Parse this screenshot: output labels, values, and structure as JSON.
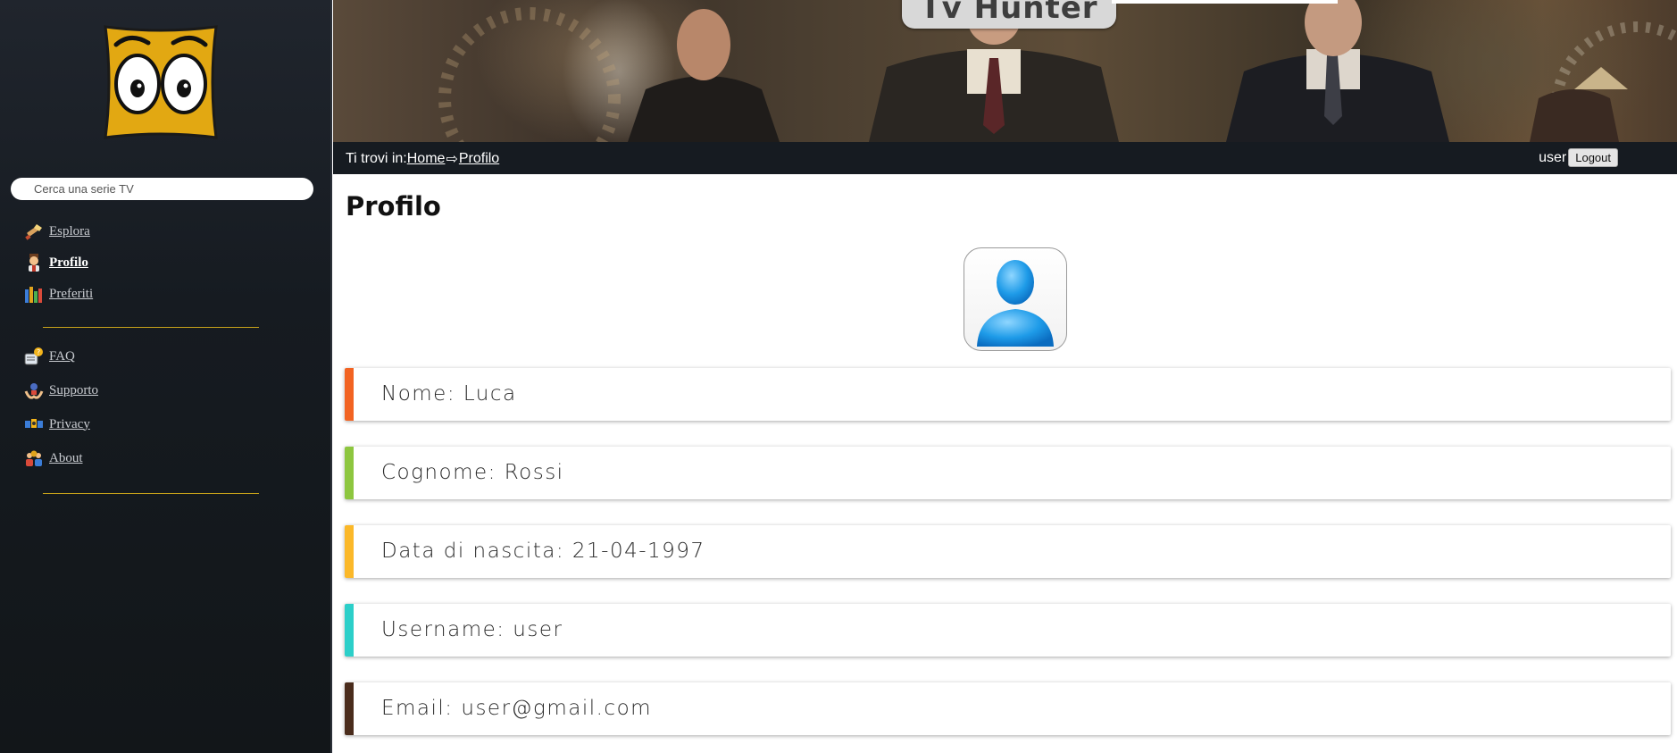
{
  "app": {
    "title": "Tv Hunter"
  },
  "search": {
    "placeholder": "Cerca una serie TV"
  },
  "sidebar": {
    "items": [
      {
        "label": "Esplora",
        "icon": "flashlight-icon"
      },
      {
        "label": "Profilo",
        "icon": "person-icon",
        "active": true
      },
      {
        "label": "Preferiti",
        "icon": "books-icon"
      }
    ],
    "items2": [
      {
        "label": "FAQ",
        "icon": "faq-icon"
      },
      {
        "label": "Supporto",
        "icon": "support-icon"
      },
      {
        "label": "Privacy",
        "icon": "privacy-icon"
      },
      {
        "label": "About",
        "icon": "team-icon"
      }
    ]
  },
  "breadcrumb": {
    "prefix": "Ti trovi in:",
    "home": "Home",
    "separator": "⇨",
    "current": "Profilo"
  },
  "user": {
    "name": "user",
    "logout_label": "Logout"
  },
  "main": {
    "title": "Profilo",
    "fields": [
      {
        "text": "Nome: Luca",
        "color": "#f26322"
      },
      {
        "text": "Cognome: Rossi",
        "color": "#8dc63f"
      },
      {
        "text": "Data di nascita: 21-04-1997",
        "color": "#fbb829"
      },
      {
        "text": "Username: user",
        "color": "#2ccfc9"
      },
      {
        "text": "Email: user@gmail.com",
        "color": "#4a2c1c"
      }
    ]
  },
  "colors": {
    "sidebar_bg": "#161b21",
    "divider": "#c7a21a",
    "logo_yellow": "#e2a812"
  }
}
